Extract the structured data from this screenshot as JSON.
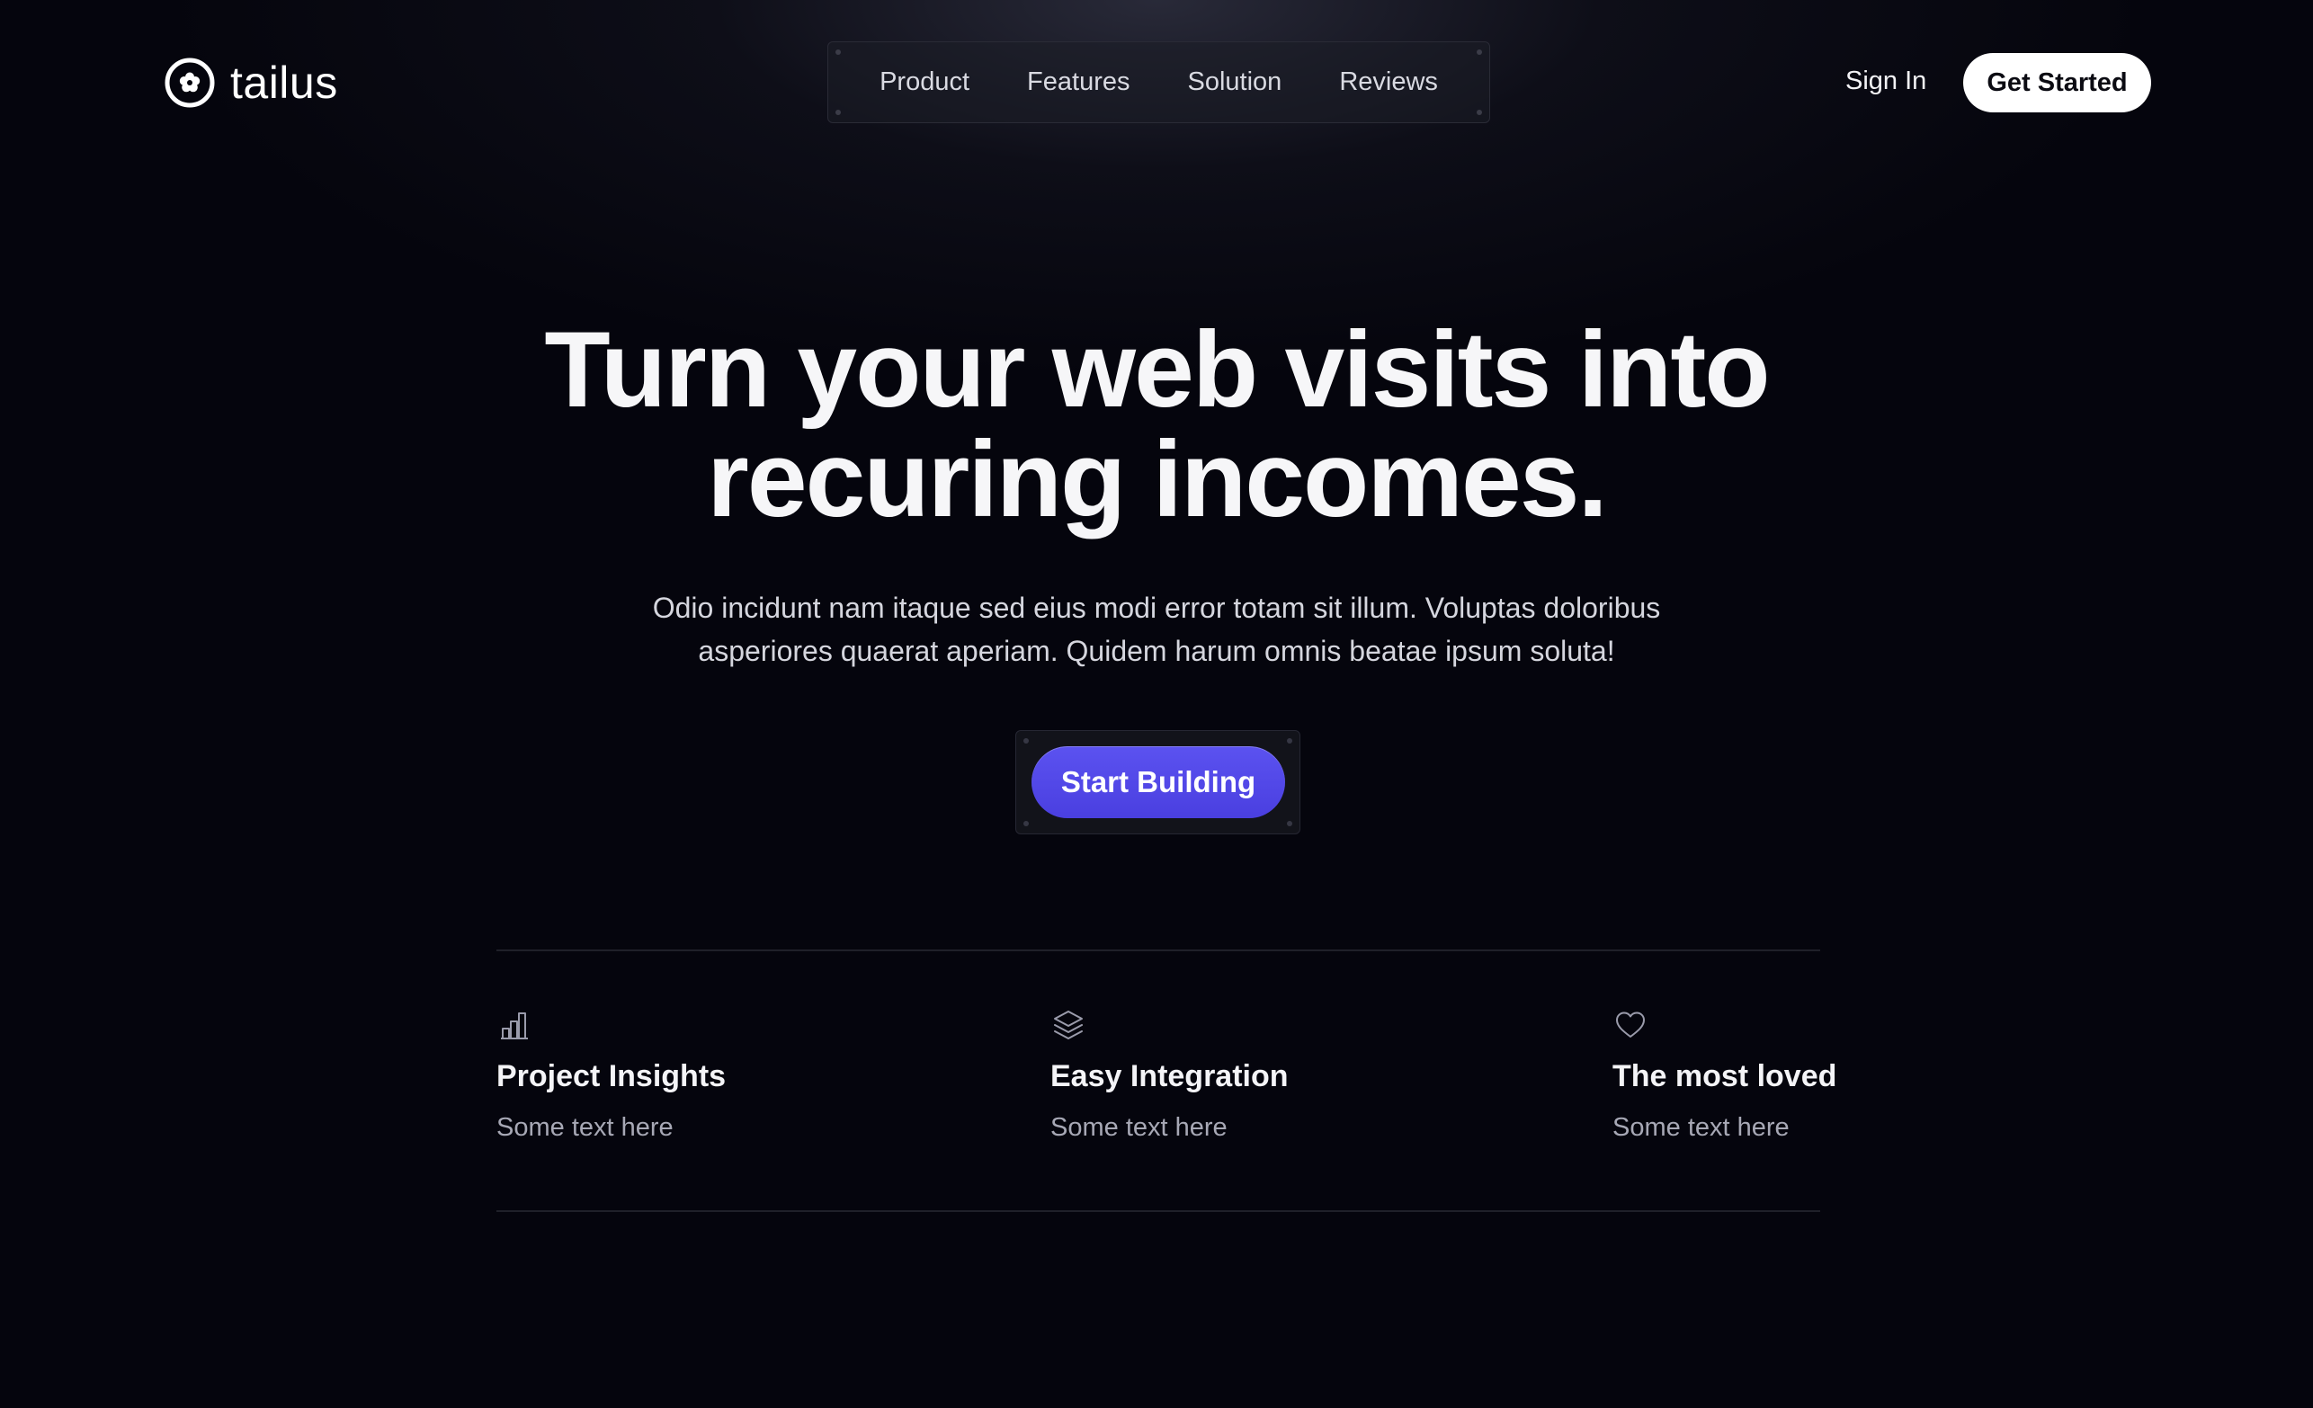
{
  "brand": {
    "name": "tailus",
    "logo_icon": "flower-circle-icon"
  },
  "nav": {
    "items": [
      {
        "label": "Product"
      },
      {
        "label": "Features"
      },
      {
        "label": "Solution"
      },
      {
        "label": "Reviews"
      }
    ]
  },
  "header": {
    "sign_in_label": "Sign In",
    "get_started_label": "Get Started"
  },
  "hero": {
    "title_line1": "Turn your web visits into",
    "title_line2": "recuring incomes.",
    "subtitle_line1": "Odio incidunt nam itaque sed eius modi error totam sit illum. Voluptas doloribus",
    "subtitle_line2": "asperiores quaerat aperiam. Quidem harum omnis beatae ipsum soluta!",
    "cta_label": "Start Building"
  },
  "features": [
    {
      "icon": "bar-chart-icon",
      "title": "Project Insights",
      "text": "Some text here"
    },
    {
      "icon": "layers-icon",
      "title": "Easy Integration",
      "text": "Some text here"
    },
    {
      "icon": "heart-icon",
      "title": "The most loved",
      "text": "Some text here"
    }
  ],
  "colors": {
    "background": "#05050d",
    "accent": "#4f46e5",
    "muted_text": "#a7a8b5"
  }
}
